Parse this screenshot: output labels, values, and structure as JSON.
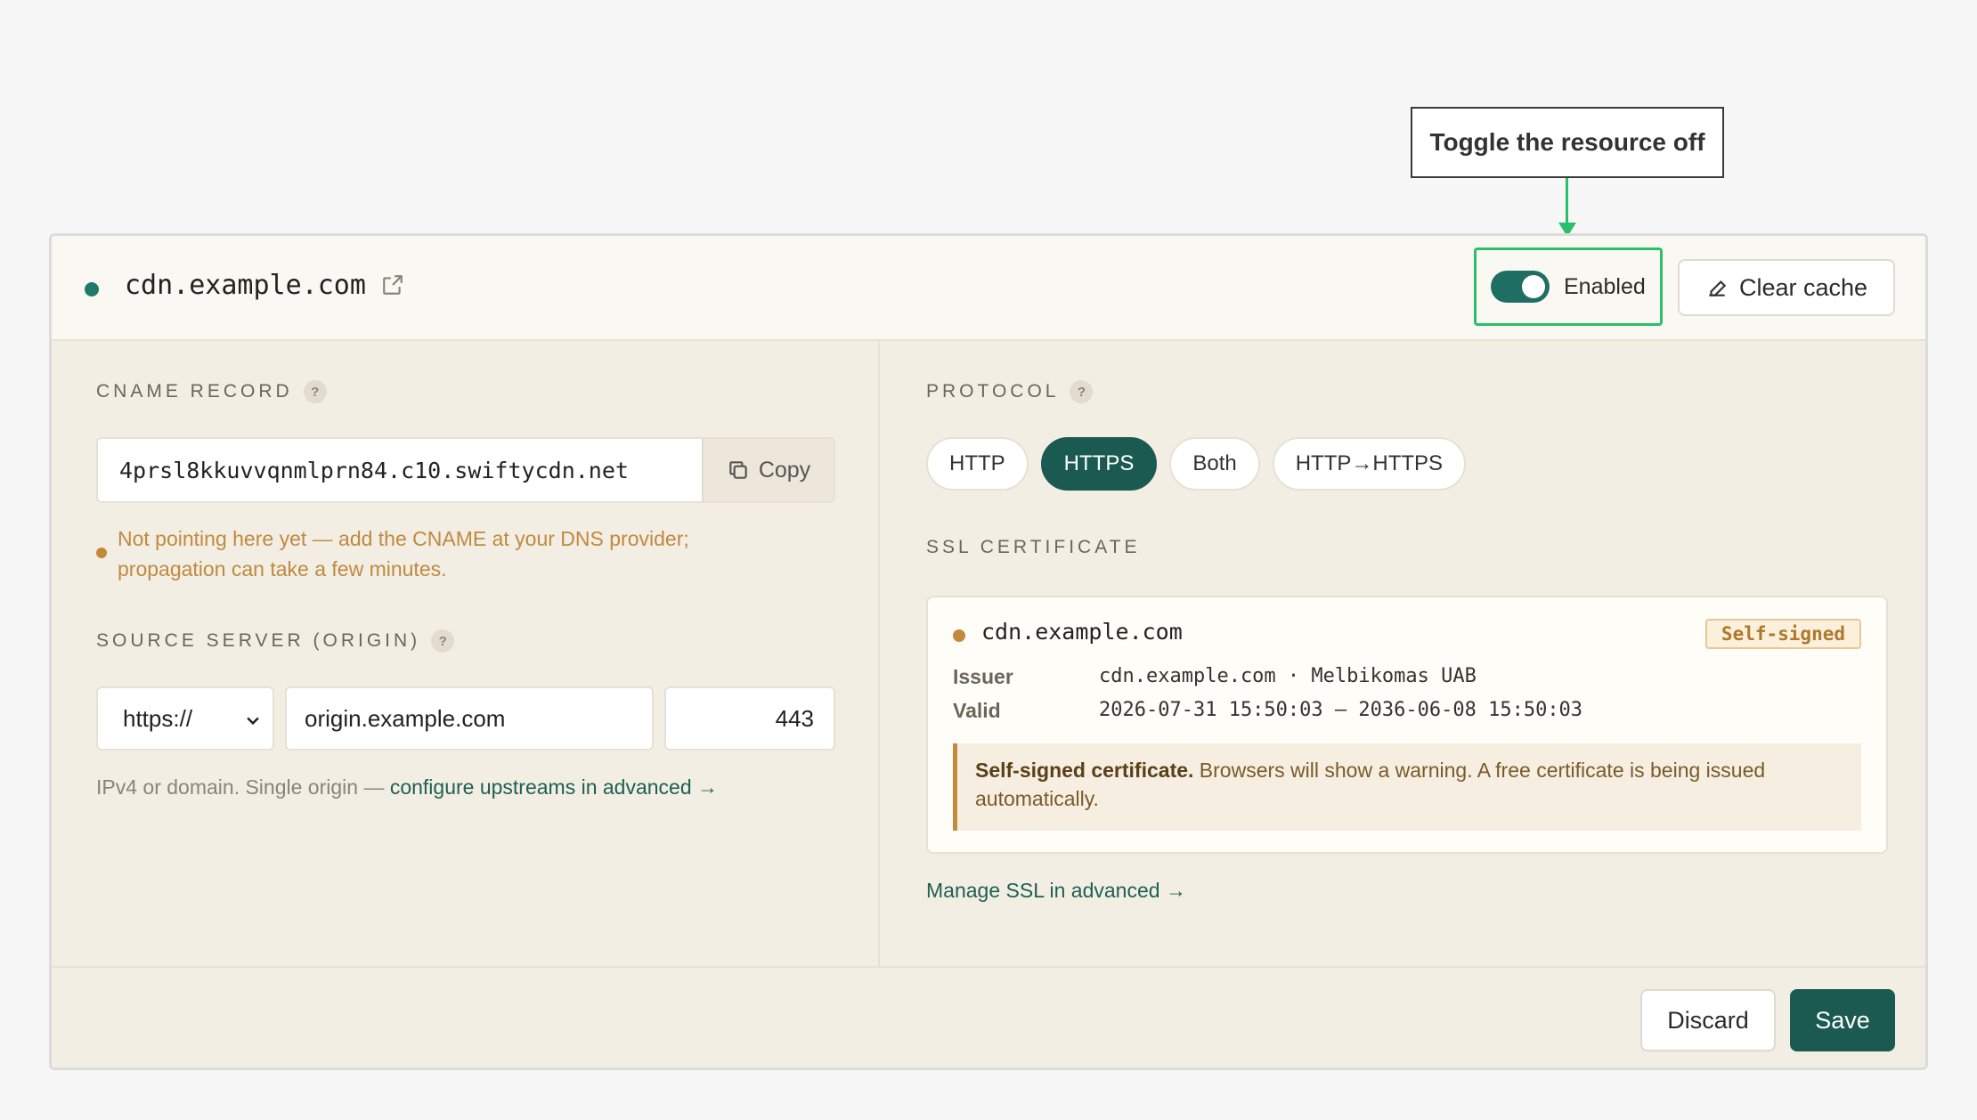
{
  "callout": {
    "text": "Toggle the resource off"
  },
  "header": {
    "domain": "cdn.example.com",
    "toggle_label": "Enabled",
    "toggle_state": "on",
    "clear_cache_label": "Clear cache",
    "status_color": "#1f7a6a"
  },
  "cname": {
    "label": "CNAME RECORD",
    "help": "?",
    "value": "4prsl8kkuvvqnmlprn84.c10.swiftycdn.net",
    "copy_label": "Copy",
    "warning": "Not pointing here yet — add the CNAME at your DNS provider; propagation can take a few minutes."
  },
  "origin": {
    "label": "SOURCE SERVER (ORIGIN)",
    "help": "?",
    "scheme": "https://",
    "host": "origin.example.com",
    "port": "443",
    "hint": "IPv4 or domain. Single origin — ",
    "hint_link": "configure upstreams in advanced →"
  },
  "protocol": {
    "label": "PROTOCOL",
    "help": "?",
    "options": [
      "HTTP",
      "HTTPS",
      "Both",
      "HTTP→HTTPS"
    ],
    "selected": "HTTPS"
  },
  "ssl": {
    "label": "SSL CERTIFICATE",
    "domain": "cdn.example.com",
    "badge": "Self-signed",
    "issuer_key": "Issuer",
    "issuer_value": "cdn.example.com · Melbikomas UAB",
    "valid_key": "Valid",
    "valid_value": "2026-07-31 15:50:03 — 2036-06-08 15:50:03",
    "notice_bold": "Self-signed certificate.",
    "notice_text": " Browsers will show a warning. A free certificate is being issued automatically.",
    "manage_link": "Manage SSL in advanced →"
  },
  "footer": {
    "discard_label": "Discard",
    "save_label": "Save"
  },
  "colors": {
    "accent": "#1b5a51",
    "highlight": "#2cbf6a",
    "warning": "#c48a3c"
  }
}
